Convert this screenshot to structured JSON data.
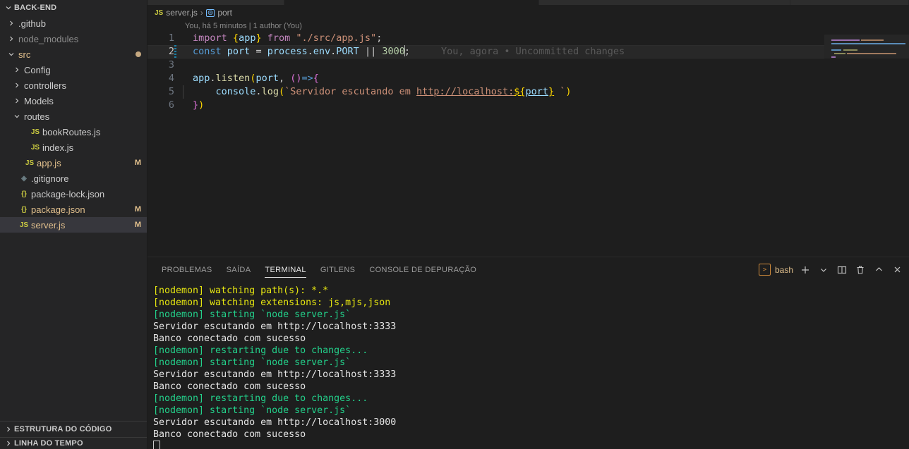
{
  "sidebar": {
    "header": {
      "label": "BACK-END",
      "twisty": "chevron-down-icon"
    },
    "tree": [
      {
        "label": ".github",
        "depth": 1,
        "arrow": "chevron-right-icon",
        "icon": "",
        "icon_kind": "none",
        "color": "c-default",
        "badge": ""
      },
      {
        "label": "node_modules",
        "depth": 1,
        "arrow": "chevron-right-icon",
        "icon": "",
        "icon_kind": "none",
        "color": "c-dim",
        "badge": ""
      },
      {
        "label": "src",
        "depth": 1,
        "arrow": "chevron-down-icon",
        "icon": "",
        "icon_kind": "none",
        "color": "c-modified",
        "badge": "",
        "dot": true
      },
      {
        "label": "Config",
        "depth": 2,
        "arrow": "chevron-right-icon",
        "icon": "",
        "icon_kind": "none",
        "color": "c-default",
        "badge": ""
      },
      {
        "label": "controllers",
        "depth": 2,
        "arrow": "chevron-right-icon",
        "icon": "",
        "icon_kind": "none",
        "color": "c-default",
        "badge": ""
      },
      {
        "label": "Models",
        "depth": 2,
        "arrow": "chevron-right-icon",
        "icon": "",
        "icon_kind": "none",
        "color": "c-default",
        "badge": ""
      },
      {
        "label": "routes",
        "depth": 2,
        "arrow": "chevron-down-icon",
        "icon": "",
        "icon_kind": "none",
        "color": "c-default",
        "badge": ""
      },
      {
        "label": "bookRoutes.js",
        "depth": 3,
        "arrow": "",
        "icon": "JS",
        "icon_kind": "js",
        "color": "c-default",
        "badge": ""
      },
      {
        "label": "index.js",
        "depth": 3,
        "arrow": "",
        "icon": "JS",
        "icon_kind": "js",
        "color": "c-default",
        "badge": ""
      },
      {
        "label": "app.js",
        "depth": 2,
        "arrow": "",
        "icon": "JS",
        "icon_kind": "js",
        "color": "c-modified",
        "badge": "M"
      },
      {
        "label": ".gitignore",
        "depth": 1,
        "arrow": "",
        "icon": "◈",
        "icon_kind": "git",
        "color": "c-default",
        "badge": ""
      },
      {
        "label": "package-lock.json",
        "depth": 1,
        "arrow": "",
        "icon": "{}",
        "icon_kind": "json",
        "color": "c-default",
        "badge": ""
      },
      {
        "label": "package.json",
        "depth": 1,
        "arrow": "",
        "icon": "{}",
        "icon_kind": "json",
        "color": "c-modified",
        "badge": "M"
      },
      {
        "label": "server.js",
        "depth": 1,
        "arrow": "",
        "icon": "JS",
        "icon_kind": "js",
        "color": "c-modified",
        "badge": "M",
        "selected": true
      }
    ],
    "bottom_sections": [
      {
        "label": "ESTRUTURA DO CÓDIGO"
      },
      {
        "label": "LINHA DO TEMPO"
      }
    ]
  },
  "breadcrumb": {
    "file_icon": "JS",
    "file": "server.js",
    "separator": "›",
    "symbol_icon": "variable-icon",
    "symbol": "port"
  },
  "editor": {
    "blame_header": "You, há 5 minutos | 1 author (You)",
    "inline_blame": "You, agora • Uncommitted changes",
    "lines": [
      {
        "n": "1",
        "text": "import {app} from \"./src/app.js\";"
      },
      {
        "n": "2",
        "text": "const port = process.env.PORT || 3000;",
        "current": true
      },
      {
        "n": "3",
        "text": ""
      },
      {
        "n": "4",
        "text": "app.listen(port, ()=>{"
      },
      {
        "n": "5",
        "text": "    console.log(`Servidor escutando em http://localhost:${port} `)"
      },
      {
        "n": "6",
        "text": "})"
      }
    ],
    "tokens": {
      "l1": {
        "import": "import",
        "brace_open": "{",
        "app": "app",
        "brace_close": "}",
        "from": "from",
        "string": "\"./src/app.js\"",
        "semi": ";"
      },
      "l2": {
        "const": "const",
        "port": "port",
        "eq": "=",
        "process": "process",
        "dot1": ".",
        "env": "env",
        "dot2": ".",
        "PORT": "PORT",
        "or": "||",
        "num": "3000",
        "semi": ";"
      },
      "l4": {
        "app": "app",
        "dot": ".",
        "listen": "listen",
        "paren_open": "(",
        "port": "port",
        "comma": ",",
        "arrow_parens": "()",
        "arrow": "=>",
        "brace": "{"
      },
      "l5": {
        "console": "console",
        "dot": ".",
        "log": "log",
        "paren": "(",
        "tick_open": "`",
        "str1": "Servidor escutando em ",
        "url": "http://localhost:",
        "tmpl_open": "${",
        "port": "port",
        "tmpl_close": "}",
        "space": " ",
        "tick_close": "`",
        "paren_close": ")"
      },
      "l6": {
        "brace": "}",
        "paren": ")"
      }
    }
  },
  "panel": {
    "tabs": [
      {
        "label": "PROBLEMAS",
        "active": false
      },
      {
        "label": "SAÍDA",
        "active": false
      },
      {
        "label": "TERMINAL",
        "active": true
      },
      {
        "label": "GITLENS",
        "active": false
      },
      {
        "label": "CONSOLE DE DEPURAÇÃO",
        "active": false
      }
    ],
    "actions": {
      "shell_icon": "terminal-icon",
      "shell_label": "bash",
      "new_terminal": "plus-icon",
      "dropdown": "chevron-down-icon",
      "split": "split-editor-icon",
      "kill": "trash-icon",
      "maximize": "chevron-up-icon",
      "close": "close-icon"
    },
    "terminal_lines": [
      {
        "text": "[nodemon] watching path(s): *.*",
        "color": "t-yellow"
      },
      {
        "text": "[nodemon] watching extensions: js,mjs,json",
        "color": "t-yellow"
      },
      {
        "text": "[nodemon] starting `node server.js`",
        "color": "t-green"
      },
      {
        "text": "Servidor escutando em http://localhost:3333",
        "color": "t-white"
      },
      {
        "text": "Banco conectado com sucesso",
        "color": "t-white"
      },
      {
        "text": "[nodemon] restarting due to changes...",
        "color": "t-green"
      },
      {
        "text": "[nodemon] starting `node server.js`",
        "color": "t-green"
      },
      {
        "text": "Servidor escutando em http://localhost:3333",
        "color": "t-white"
      },
      {
        "text": "Banco conectado com sucesso",
        "color": "t-white"
      },
      {
        "text": "[nodemon] restarting due to changes...",
        "color": "t-green"
      },
      {
        "text": "[nodemon] starting `node server.js`",
        "color": "t-green"
      },
      {
        "text": "Servidor escutando em http://localhost:3000",
        "color": "t-white"
      },
      {
        "text": "Banco conectado com sucesso",
        "color": "t-white"
      }
    ]
  },
  "colors": {
    "editor_bg": "#1e1e1e",
    "sidebar_bg": "#252526",
    "selection_bg": "#37373d",
    "modified_fg": "#e2c08d",
    "terminal_green": "#23d18b",
    "terminal_yellow": "#e5e510",
    "accent_blue": "#179fff"
  }
}
